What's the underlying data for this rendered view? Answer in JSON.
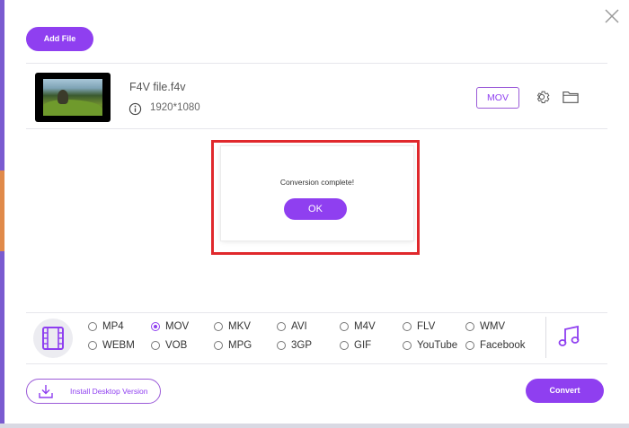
{
  "toolbar": {
    "add_file_label": "Add File"
  },
  "file": {
    "name": "F4V file.f4v",
    "resolution": "1920*1080",
    "output_format": "MOV"
  },
  "popup": {
    "message": "Conversion complete!",
    "ok_label": "OK"
  },
  "formats": [
    {
      "label": "MP4",
      "selected": false
    },
    {
      "label": "MOV",
      "selected": true
    },
    {
      "label": "MKV",
      "selected": false
    },
    {
      "label": "AVI",
      "selected": false
    },
    {
      "label": "M4V",
      "selected": false
    },
    {
      "label": "FLV",
      "selected": false
    },
    {
      "label": "WMV",
      "selected": false
    },
    {
      "label": "WEBM",
      "selected": false
    },
    {
      "label": "VOB",
      "selected": false
    },
    {
      "label": "MPG",
      "selected": false
    },
    {
      "label": "3GP",
      "selected": false
    },
    {
      "label": "GIF",
      "selected": false
    },
    {
      "label": "YouTube",
      "selected": false
    },
    {
      "label": "Facebook",
      "selected": false
    }
  ],
  "footer": {
    "install_label": "Install Desktop Version",
    "convert_label": "Convert"
  },
  "colors": {
    "accent": "#8f3ff0",
    "highlight_border": "#e0282c"
  },
  "icons": [
    "close-icon",
    "info-icon",
    "gear-icon",
    "folder-icon",
    "video-format-icon",
    "music-note-icon",
    "download-icon"
  ]
}
